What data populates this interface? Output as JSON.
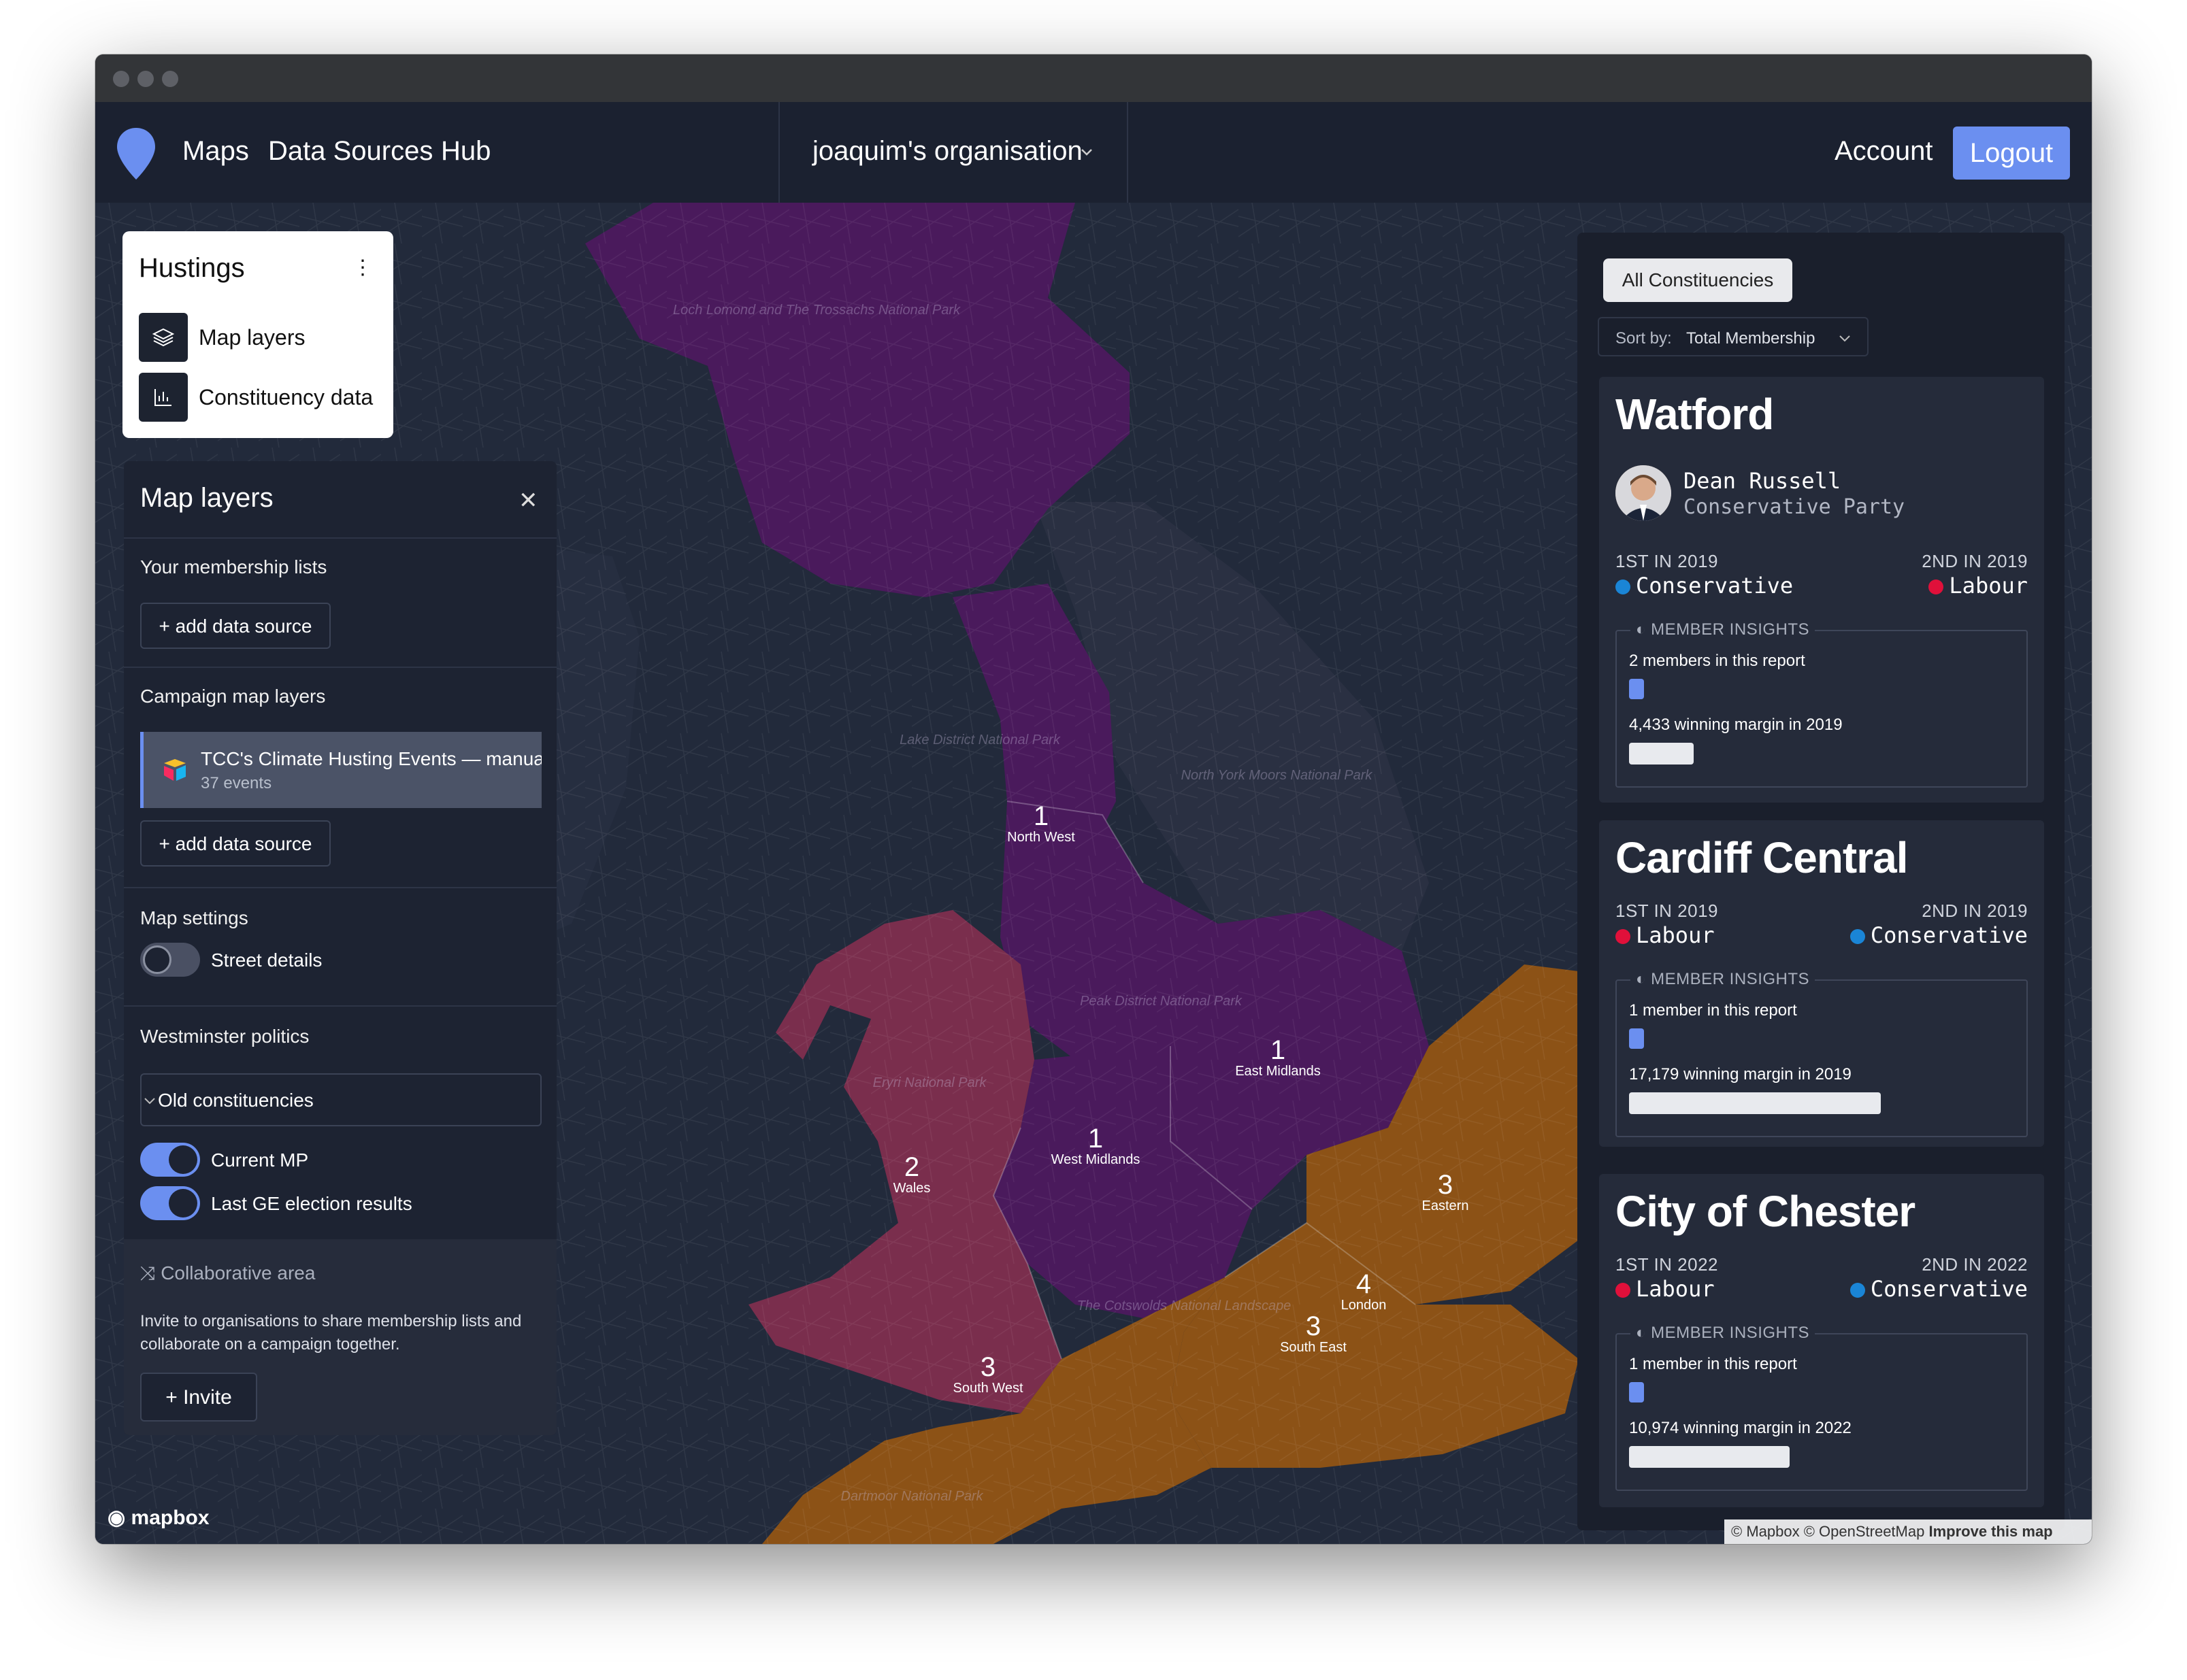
{
  "nav": {
    "links": [
      "Maps",
      "Data Sources",
      "Hub"
    ],
    "organisation": "joaquim's organisation",
    "account": "Account",
    "logout": "Logout"
  },
  "hustings": {
    "title": "Hustings",
    "items": [
      "Map layers",
      "Constituency data"
    ]
  },
  "layers_panel": {
    "title": "Map layers",
    "membership_label": "Your membership lists",
    "add_data_source": "+ add data source",
    "campaign_label": "Campaign map layers",
    "layer_name": "TCC's Climate Husting Events — manual",
    "layer_count": "37 events",
    "settings_label": "Map settings",
    "street_details": "Street details",
    "street_details_on": false,
    "westminster_label": "Westminster politics",
    "constituency_select": "Old constituencies",
    "current_mp": "Current MP",
    "current_mp_on": true,
    "last_ge": "Last GE election results",
    "last_ge_on": true,
    "collab_title": "Collaborative area",
    "collab_desc": "Invite to organisations to share membership lists and collaborate on a campaign together.",
    "invite": "Invite"
  },
  "map": {
    "regions": [
      {
        "count": "1",
        "name": "North West"
      },
      {
        "count": "1",
        "name": "East Midlands"
      },
      {
        "count": "1",
        "name": "West Midlands"
      },
      {
        "count": "2",
        "name": "Wales"
      },
      {
        "count": "3",
        "name": "Eastern"
      },
      {
        "count": "4",
        "name": "London"
      },
      {
        "count": "3",
        "name": "South East"
      },
      {
        "count": "3",
        "name": "South West"
      }
    ],
    "parks": [
      "Loch Lomond and The Trossachs National Park",
      "Lake District National Park",
      "North York Moors National Park",
      "Peak District National Park",
      "Eryri National Park",
      "The Cotswolds National Landscape",
      "Dartmoor National Park"
    ],
    "logo": "mapbox",
    "attribution": "© Mapbox © OpenStreetMap",
    "improve": "Improve this map",
    "colors": {
      "wales": "#7a2e4d",
      "purple": "#4a1a5c",
      "orange": "#8c5216"
    }
  },
  "constituencies": {
    "filter": "All Constituencies",
    "sort_label": "Sort by:",
    "sort_value": "Total Membership",
    "cards": [
      {
        "name": "Watford",
        "mp_name": "Dean Russell",
        "mp_party": "Conservative Party",
        "first_label": "1ST IN 2019",
        "first_party": "Conservative",
        "first_color": "#1a85d6",
        "second_label": "2ND IN 2019",
        "second_party": "Labour",
        "second_color": "#e0103a",
        "insights_label": "MEMBER INSIGHTS",
        "members": "2 members in this report",
        "margin": "4,433 winning margin in 2019",
        "margin_value": 4433
      },
      {
        "name": "Cardiff Central",
        "first_label": "1ST IN 2019",
        "first_party": "Labour",
        "first_color": "#e0103a",
        "second_label": "2ND IN 2019",
        "second_party": "Conservative",
        "second_color": "#1a85d6",
        "insights_label": "MEMBER INSIGHTS",
        "members": "1 member in this report",
        "margin": "17,179 winning margin in 2019",
        "margin_value": 17179
      },
      {
        "name": "City of Chester",
        "first_label": "1ST IN 2022",
        "first_party": "Labour",
        "first_color": "#e0103a",
        "second_label": "2ND IN 2022",
        "second_party": "Conservative",
        "second_color": "#1a85d6",
        "insights_label": "MEMBER INSIGHTS",
        "members": "1 member in this report",
        "margin": "10,974 winning margin in 2022",
        "margin_value": 10974
      }
    ]
  }
}
